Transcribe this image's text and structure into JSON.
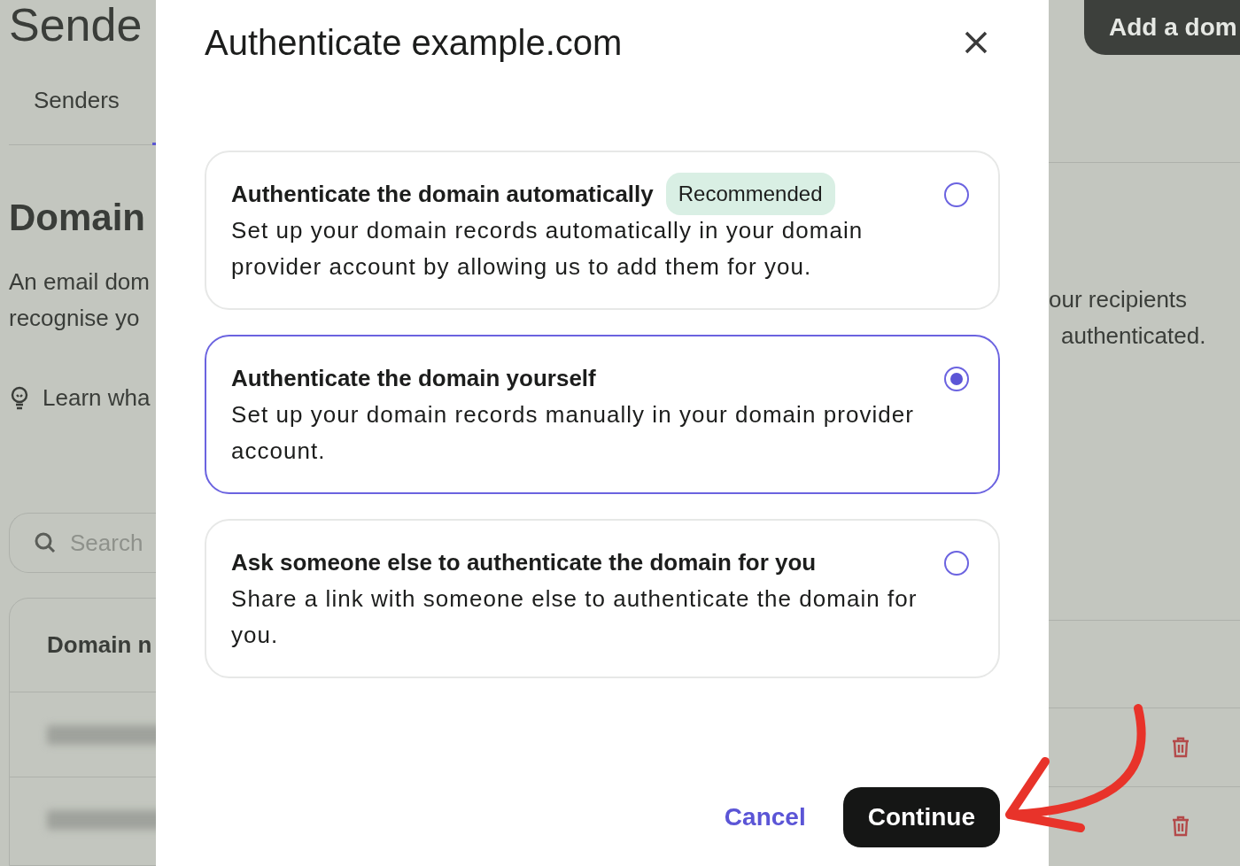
{
  "background": {
    "page_title": "Sende",
    "tabs": [
      {
        "label": "Senders",
        "selected": false
      }
    ],
    "section_title": "Domain",
    "description_left": [
      "An email dom",
      "recognise yo"
    ],
    "description_right": [
      "our recipients",
      "authenticated."
    ],
    "learn_link": "Learn wha",
    "search": {
      "placeholder": "Search"
    },
    "table": {
      "column_1": "Domain n"
    },
    "add_button": "Add a dom"
  },
  "dialog": {
    "title": "Authenticate example.com",
    "options": [
      {
        "title": "Authenticate the domain automatically",
        "badge": "Recommended",
        "description": "Set up your domain records automatically in your domain provider account by allowing us to add them for you.",
        "selected": false
      },
      {
        "title": "Authenticate the domain yourself",
        "description": "Set up your domain records manually in your domain provider account.",
        "selected": true
      },
      {
        "title": "Ask someone else to authenticate the domain for you",
        "description": "Share a link with someone else to authenticate the domain for you.",
        "selected": false
      }
    ],
    "cancel": "Cancel",
    "continue": "Continue"
  }
}
